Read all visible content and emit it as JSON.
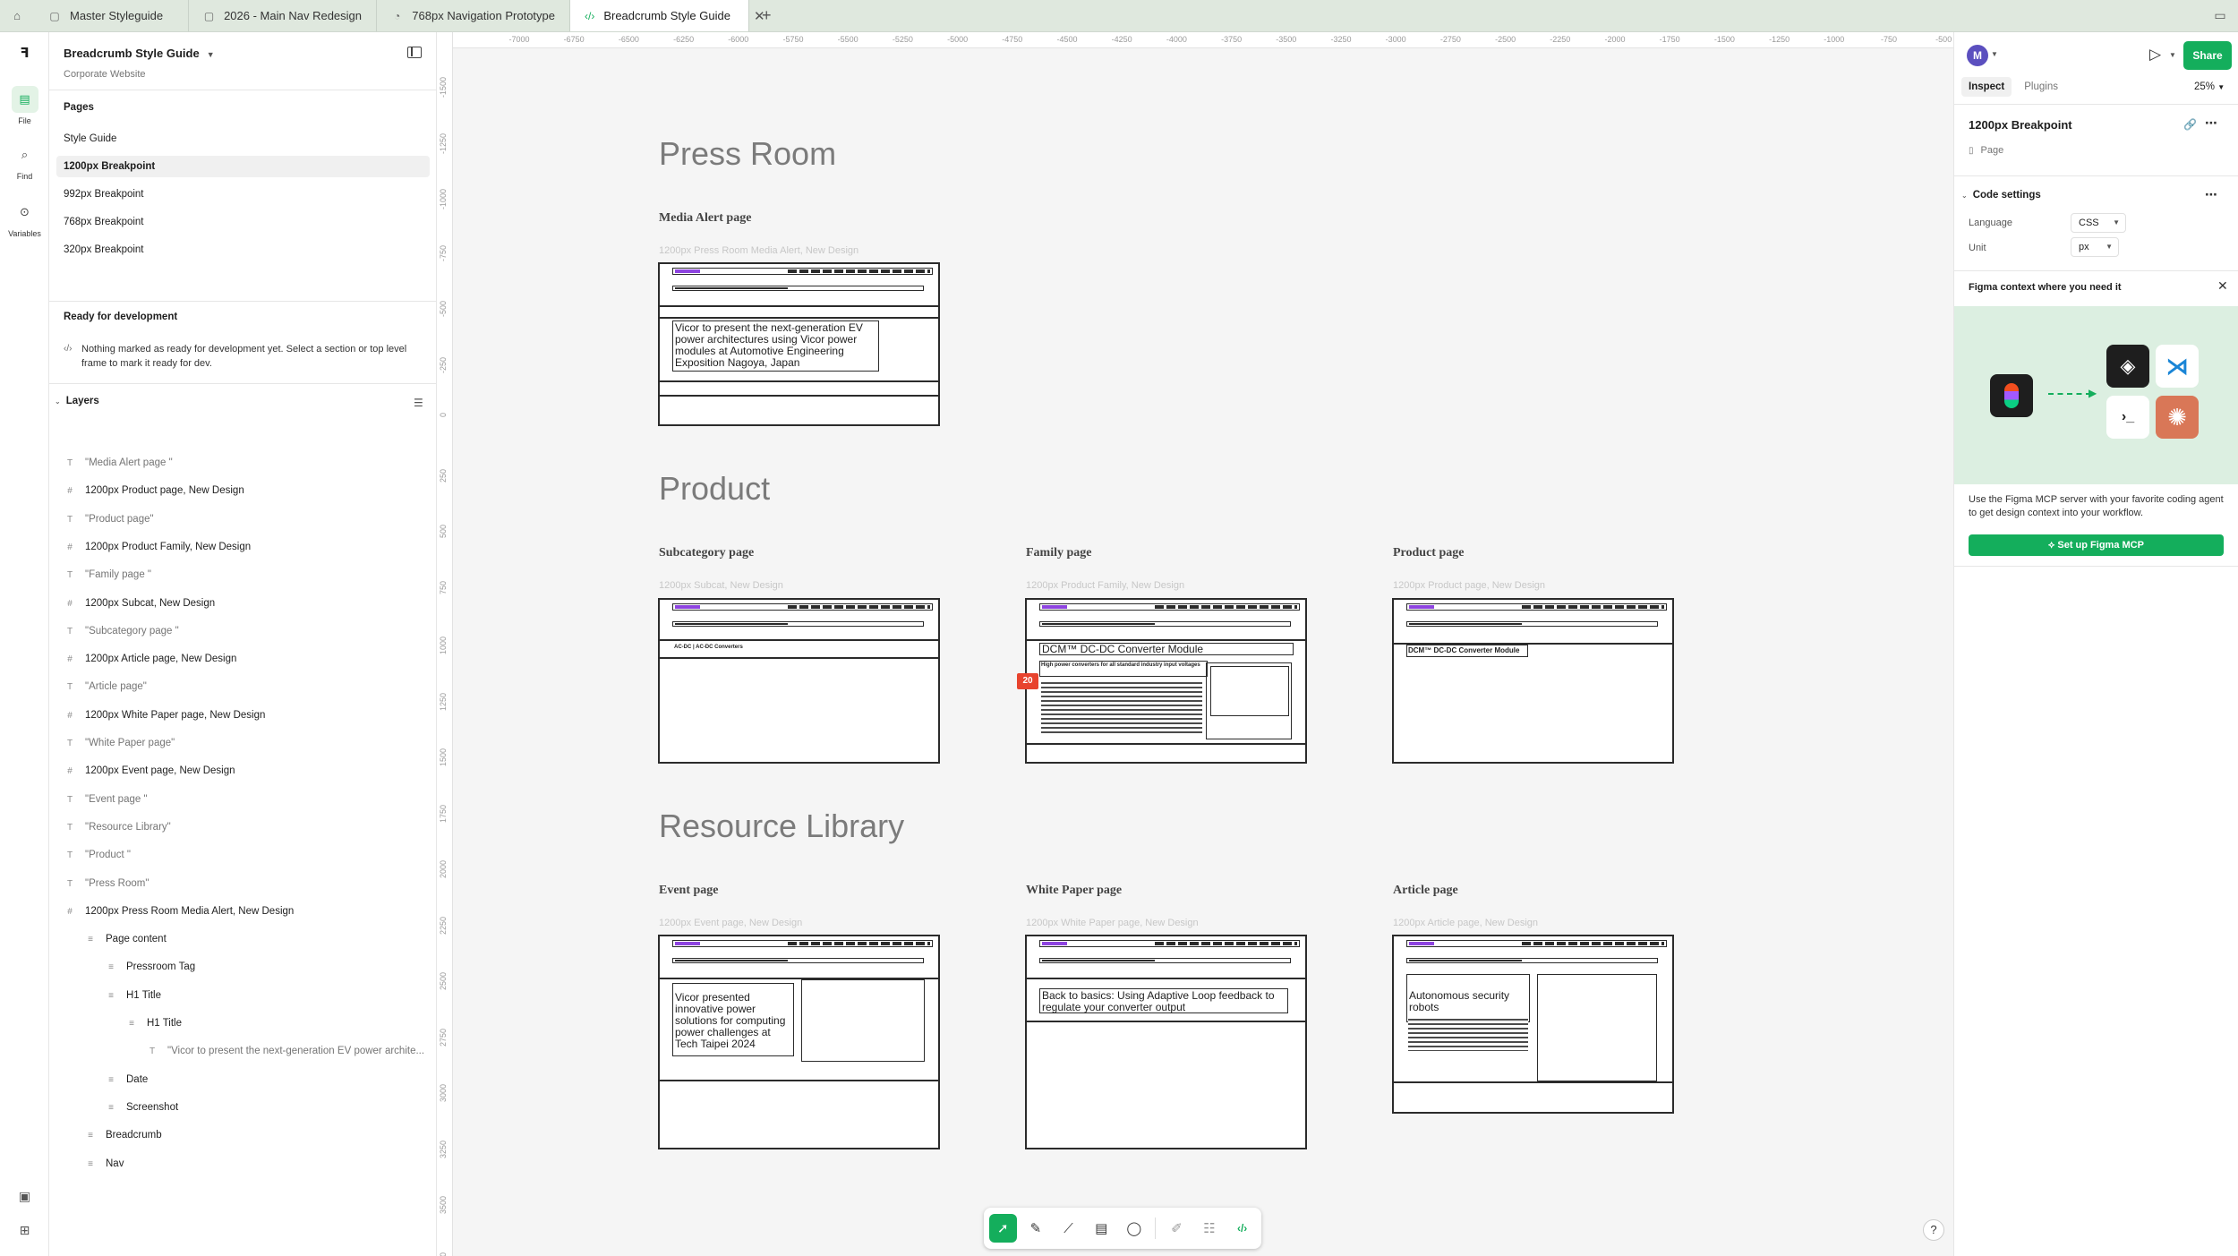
{
  "tabs": [
    {
      "label": "Master Styleguide",
      "icon": "file-icon"
    },
    {
      "label": "2026 - Main Nav Redesign",
      "icon": "file-icon"
    },
    {
      "label": "768px Navigation Prototype",
      "icon": "prototype-icon"
    },
    {
      "label": "Breadcrumb Style Guide",
      "icon": "code-icon",
      "active": true
    }
  ],
  "rail": {
    "file": "File",
    "find": "Find",
    "variables": "Variables"
  },
  "left": {
    "file_title": "Breadcrumb Style Guide",
    "project": "Corporate Website",
    "pages_heading": "Pages",
    "pages": [
      "Style Guide",
      "1200px Breakpoint",
      "992px Breakpoint",
      "768px Breakpoint",
      "320px Breakpoint"
    ],
    "ready_heading": "Ready for development",
    "ready_text": "Nothing marked as ready for development yet. Select a section or top level frame to mark it ready for dev.",
    "layers_heading": "Layers",
    "layers": [
      {
        "label": "\"Media Alert page \"",
        "kind": "text",
        "depth": 0
      },
      {
        "label": "1200px Product page, New Design",
        "kind": "frame",
        "depth": 0
      },
      {
        "label": "\"Product page\"",
        "kind": "text",
        "depth": 0
      },
      {
        "label": "1200px Product Family, New Design",
        "kind": "frame",
        "depth": 0
      },
      {
        "label": "\"Family page \"",
        "kind": "text",
        "depth": 0
      },
      {
        "label": "1200px Subcat, New Design",
        "kind": "frame",
        "depth": 0
      },
      {
        "label": "\"Subcategory page \"",
        "kind": "text",
        "depth": 0
      },
      {
        "label": "1200px Article page, New Design",
        "kind": "frame",
        "depth": 0
      },
      {
        "label": "\"Article page\"",
        "kind": "text",
        "depth": 0
      },
      {
        "label": "1200px White Paper page, New Design",
        "kind": "frame",
        "depth": 0
      },
      {
        "label": "\"White Paper page\"",
        "kind": "text",
        "depth": 0
      },
      {
        "label": "1200px Event page, New Design",
        "kind": "frame",
        "depth": 0
      },
      {
        "label": "\"Event page \"",
        "kind": "text",
        "depth": 0
      },
      {
        "label": "\"Resource Library\"",
        "kind": "text",
        "depth": 0
      },
      {
        "label": "\"Product \"",
        "kind": "text",
        "depth": 0
      },
      {
        "label": "\"Press Room\"",
        "kind": "text",
        "depth": 0
      },
      {
        "label": "1200px Press Room Media Alert, New Design",
        "kind": "frame",
        "depth": 0
      },
      {
        "label": "Page content",
        "kind": "autolayout",
        "depth": 1
      },
      {
        "label": "Pressroom Tag",
        "kind": "autolayout",
        "depth": 2
      },
      {
        "label": "H1 Title",
        "kind": "autolayout",
        "depth": 2
      },
      {
        "label": "H1 Title",
        "kind": "autolayout",
        "depth": 3
      },
      {
        "label": "\"Vicor to present the next-generation EV power archite...",
        "kind": "text",
        "depth": 4
      },
      {
        "label": "Date",
        "kind": "autolayout",
        "depth": 2
      },
      {
        "label": "Screenshot",
        "kind": "autolayout",
        "depth": 2
      },
      {
        "label": "Breadcrumb",
        "kind": "autolayout",
        "depth": 1
      },
      {
        "label": "Nav",
        "kind": "autolayout",
        "depth": 1
      }
    ]
  },
  "canvas": {
    "ruler_x": [
      "-7000",
      "-6750",
      "-6500",
      "-6250",
      "-6000",
      "-5750",
      "-5500",
      "-5250",
      "-5000",
      "-4750",
      "-4500",
      "-4250",
      "-4000",
      "-3750",
      "-3500",
      "-3250",
      "-3000",
      "-2750",
      "-2500",
      "-2250",
      "-2000",
      "-1750",
      "-1500",
      "-1250",
      "-1000",
      "-750",
      "-500"
    ],
    "ruler_y": [
      "-1500",
      "-1250",
      "-1000",
      "-750",
      "-500",
      "-250",
      "0",
      "250",
      "500",
      "750",
      "1000",
      "1250",
      "1500",
      "1750",
      "2000",
      "2250",
      "2500",
      "2750",
      "3000",
      "3250",
      "3500",
      "3750"
    ],
    "sections": {
      "press_room": "Press Room",
      "product": "Product",
      "resource_library": "Resource Library"
    },
    "frames": {
      "media_alert": {
        "label": "Media Alert page",
        "caption": "1200px Press Room Media Alert, New Design",
        "heading": "Vicor to present the next-generation EV power architectures using Vicor power modules at Automotive Engineering Exposition Nagoya, Japan"
      },
      "subcategory": {
        "label": "Subcategory page",
        "caption": "1200px Subcat, New Design",
        "heading": "AC-DC | AC-DC Converters"
      },
      "family": {
        "label": "Family page",
        "caption": "1200px Product Family, New Design",
        "heading": "DCM™ DC-DC Converter Module",
        "subheading": "High power converters for all standard industry input voltages"
      },
      "product": {
        "label": "Product page",
        "caption": "1200px Product page, New Design",
        "heading": "DCM™ DC-DC Converter Module"
      },
      "event": {
        "label": "Event page",
        "caption": "1200px Event page, New Design",
        "heading": "Vicor presented innovative power solutions for computing power challenges at Tech Taipei 2024"
      },
      "white_paper": {
        "label": "White Paper page",
        "caption": "1200px White Paper page, New Design",
        "heading": "Back to basics: Using Adaptive Loop feedback to regulate your converter output"
      },
      "article": {
        "label": "Article page",
        "caption": "1200px Article page, New Design",
        "heading": "Autonomous security robots"
      }
    },
    "comment_badge": "20"
  },
  "toolbar": {
    "tools": [
      "move-tool",
      "pen-tool",
      "measure-tool",
      "annotate-tool",
      "comment-tool",
      "draw-tool",
      "properties-tool",
      "dev-mode-tool"
    ]
  },
  "right": {
    "avatar_initial": "M",
    "share_label": "Share",
    "tab_inspect": "Inspect",
    "tab_plugins": "Plugins",
    "zoom": "25%",
    "selection_title": "1200px Breakpoint",
    "selection_type": "Page",
    "code_settings": "Code settings",
    "language_label": "Language",
    "language_value": "CSS",
    "unit_label": "Unit",
    "unit_value": "px",
    "context_title": "Figma context where you need it",
    "context_text": "Use the Figma MCP server with your favorite coding agent to get design context into your workflow.",
    "mcp_button": "Set up Figma MCP"
  },
  "colors": {
    "accent": "#14ae5c",
    "tabbar": "#dfe8de",
    "canvas": "#f5f5f5",
    "nav_logo": "#8e44e0",
    "comment_badge": "#e8432d"
  }
}
